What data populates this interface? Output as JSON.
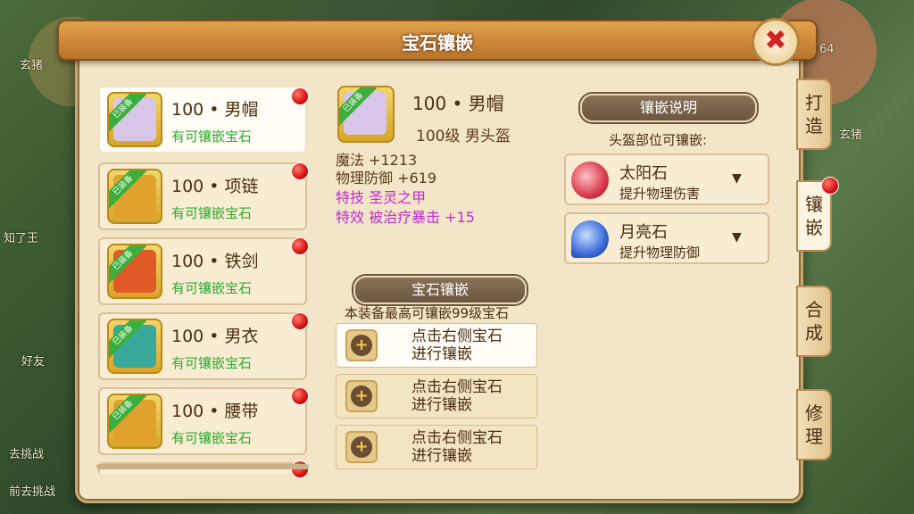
{
  "background": {
    "texts": [
      "玄猪",
      "好友",
      "去挑战",
      "前去挑战",
      "知了王",
      "64"
    ]
  },
  "window": {
    "title": "宝石镶嵌",
    "close_label": "✖"
  },
  "equipment_list": [
    {
      "name": "100 • 男帽",
      "status": "有可镶嵌宝石",
      "tag": "已装备",
      "selected": true,
      "color": "#d8c7e8"
    },
    {
      "name": "100 • 项链",
      "status": "有可镶嵌宝石",
      "tag": "已装备",
      "selected": false,
      "color": "#e0a22c"
    },
    {
      "name": "100 • 铁剑",
      "status": "有可镶嵌宝石",
      "tag": "已装备",
      "selected": false,
      "color": "#e05a28"
    },
    {
      "name": "100 • 男衣",
      "status": "有可镶嵌宝石",
      "tag": "已装备",
      "selected": false,
      "color": "#3aa89a"
    },
    {
      "name": "100 • 腰带",
      "status": "有可镶嵌宝石",
      "tag": "已装备",
      "selected": false,
      "color": "#e0a22c"
    }
  ],
  "detail": {
    "tag": "已装备",
    "name": "100 • 男帽",
    "level_desc": "100级  男头盔",
    "stats": [
      "魔法  +1213",
      "物理防御  +619"
    ],
    "skills": [
      "特技  圣灵之甲",
      "特效  被治疗暴击  +15"
    ]
  },
  "inlay_section": {
    "header": "宝石镶嵌",
    "subtitle": "本装备最高可镶嵌99级宝石",
    "slots": [
      {
        "line1": "点击右侧宝石",
        "line2": "进行镶嵌",
        "selected": true
      },
      {
        "line1": "点击右侧宝石",
        "line2": "进行镶嵌",
        "selected": false
      },
      {
        "line1": "点击右侧宝石",
        "line2": "进行镶嵌",
        "selected": false
      }
    ]
  },
  "gem_info": {
    "header": "镶嵌说明",
    "subtitle": "头盔部位可镶嵌:",
    "gems": [
      {
        "name": "太阳石",
        "desc": "提升物理伤害",
        "color": "#d93a4a"
      },
      {
        "name": "月亮石",
        "desc": "提升物理防御",
        "color": "#3a6ad9"
      }
    ]
  },
  "side_tabs": [
    {
      "line1": "打",
      "line2": "造",
      "active": false
    },
    {
      "line1": "镶",
      "line2": "嵌",
      "active": true
    },
    {
      "line1": "合",
      "line2": "成",
      "active": false
    },
    {
      "line1": "修",
      "line2": "理",
      "active": false
    }
  ]
}
